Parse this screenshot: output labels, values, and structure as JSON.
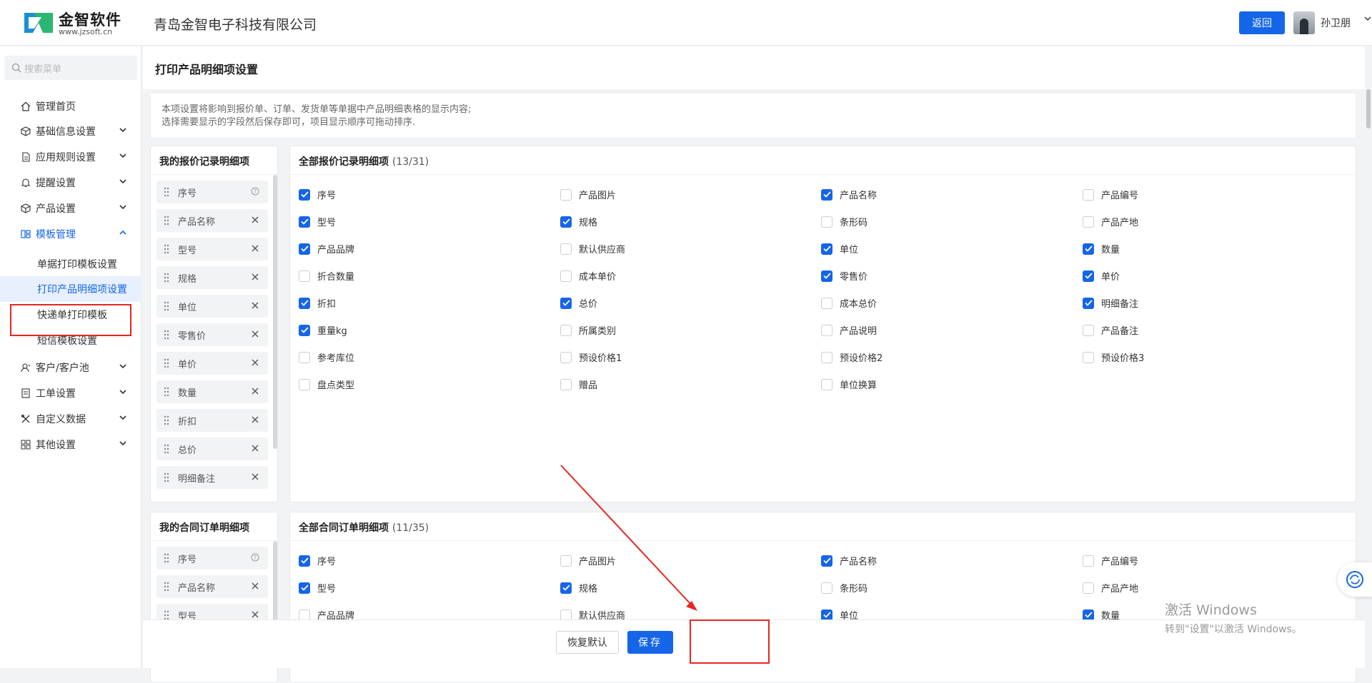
{
  "header": {
    "brand": "金智软件",
    "brand_url": "www.jzsoft.cn",
    "company": "青岛金智电子科技有限公司",
    "back_label": "返回",
    "user_name": "孙卫朋"
  },
  "sidebar": {
    "search_placeholder": "搜索菜单",
    "items": [
      {
        "label": "管理首页",
        "icon": "home-icon"
      },
      {
        "label": "基础信息设置",
        "icon": "cube-icon"
      },
      {
        "label": "应用规则设置",
        "icon": "document-icon"
      },
      {
        "label": "提醒设置",
        "icon": "bell-icon"
      },
      {
        "label": "产品设置",
        "icon": "box-icon"
      },
      {
        "label": "模板管理",
        "icon": "template-icon"
      },
      {
        "label": "客户/客户池",
        "icon": "customer-icon"
      },
      {
        "label": "工单设置",
        "icon": "ticket-icon"
      },
      {
        "label": "自定义数据",
        "icon": "tools-icon"
      },
      {
        "label": "其他设置",
        "icon": "grid-icon"
      }
    ],
    "template_sub": [
      "单据打印模板设置",
      "打印产品明细项设置",
      "快递单打印模板",
      "短信模板设置"
    ]
  },
  "page": {
    "title": "打印产品明细项设置",
    "notice_line1": "本项设置将影响到报价单、订单、发货单等单据中产品明细表格的显示内容;",
    "notice_line2": "选择需要显示的字段然后保存即可，项目显示顺序可拖动排序."
  },
  "quote": {
    "my_title": "我的报价记录明细项",
    "all_title": "全部报价记录明细项",
    "count": "(13/31)",
    "my_items": [
      "序号",
      "产品名称",
      "型号",
      "规格",
      "单位",
      "零售价",
      "单价",
      "数量",
      "折扣",
      "总价",
      "明细备注"
    ],
    "fields": [
      {
        "label": "序号",
        "checked": true
      },
      {
        "label": "产品图片",
        "checked": false
      },
      {
        "label": "产品名称",
        "checked": true
      },
      {
        "label": "产品编号",
        "checked": false
      },
      {
        "label": "型号",
        "checked": true
      },
      {
        "label": "规格",
        "checked": true
      },
      {
        "label": "条形码",
        "checked": false
      },
      {
        "label": "产品产地",
        "checked": false
      },
      {
        "label": "产品品牌",
        "checked": true
      },
      {
        "label": "默认供应商",
        "checked": false
      },
      {
        "label": "单位",
        "checked": true
      },
      {
        "label": "数量",
        "checked": true
      },
      {
        "label": "折合数量",
        "checked": false
      },
      {
        "label": "成本单价",
        "checked": false
      },
      {
        "label": "零售价",
        "checked": true
      },
      {
        "label": "单价",
        "checked": true
      },
      {
        "label": "折扣",
        "checked": true
      },
      {
        "label": "总价",
        "checked": true
      },
      {
        "label": "成本总价",
        "checked": false
      },
      {
        "label": "明细备注",
        "checked": true
      },
      {
        "label": "重量kg",
        "checked": true
      },
      {
        "label": "所属类别",
        "checked": false
      },
      {
        "label": "产品说明",
        "checked": false
      },
      {
        "label": "产品备注",
        "checked": false
      },
      {
        "label": "参考库位",
        "checked": false
      },
      {
        "label": "预设价格1",
        "checked": false
      },
      {
        "label": "预设价格2",
        "checked": false
      },
      {
        "label": "预设价格3",
        "checked": false
      },
      {
        "label": "盘点类型",
        "checked": false
      },
      {
        "label": "赠品",
        "checked": false
      },
      {
        "label": "单位换算",
        "checked": false
      }
    ]
  },
  "order": {
    "my_title": "我的合同订单明细项",
    "all_title": "全部合同订单明细项",
    "count": "(11/35)",
    "my_items": [
      "序号",
      "产品名称",
      "型号"
    ],
    "fields": [
      {
        "label": "序号",
        "checked": true
      },
      {
        "label": "产品图片",
        "checked": false
      },
      {
        "label": "产品名称",
        "checked": true
      },
      {
        "label": "产品编号",
        "checked": false
      },
      {
        "label": "型号",
        "checked": true
      },
      {
        "label": "规格",
        "checked": true
      },
      {
        "label": "条形码",
        "checked": false
      },
      {
        "label": "产品产地",
        "checked": false
      },
      {
        "label": "产品品牌",
        "checked": false
      },
      {
        "label": "默认供应商",
        "checked": false
      },
      {
        "label": "单位",
        "checked": true
      },
      {
        "label": "数量",
        "checked": true
      }
    ]
  },
  "footer": {
    "restore_label": "恢复默认",
    "save_label": "保存"
  },
  "watermark": {
    "line1": "激活 Windows",
    "line2": "转到\"设置\"以激活 Windows。"
  },
  "colors": {
    "accent": "#1565e8",
    "annotation": "#e8251f"
  }
}
